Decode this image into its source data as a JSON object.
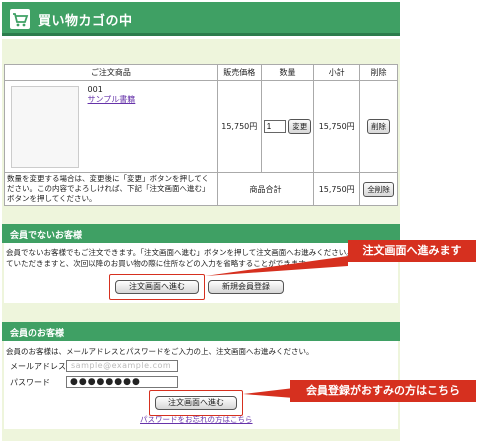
{
  "header": {
    "title": "買い物カゴの中",
    "icon": "cart-icon"
  },
  "cart_table": {
    "columns": [
      "ご注文商品",
      "販売価格",
      "数量",
      "小計",
      "削除"
    ],
    "item": {
      "code": "001",
      "name": "サンプル書籍",
      "price": "15,750円",
      "quantity": "1",
      "change_button": "変更",
      "subtotal": "15,750円",
      "delete_button": "削除"
    },
    "note": "数量を変更する場合は、変更後に「変更」ボタンを押してください。この内容でよろしければ、下記「注文画面へ進む」ボタンを押してください。",
    "total_label": "商品合計",
    "total_value": "15,750円",
    "delete_all_button": "全削除"
  },
  "guest": {
    "title": "会員でないお客様",
    "description": "会員でないお客様でもご注文できます。「注文画面へ進む」ボタンを押して注文画面へお進みください。会員登録していただきますと、次回以降のお買い物の際に住所などの入力を省略することができます。",
    "order_button": "注文画面へ進む",
    "register_button": "新規会員登録"
  },
  "member": {
    "title": "会員のお客様",
    "description": "会員のお客様は、メールアドレスとパスワードをご入力の上、注文画面へお進みください。",
    "email_label": "メールアドレス",
    "email_value": "sample@example.com",
    "password_label": "パスワード",
    "password_value": "●●●●●●●●",
    "order_button": "注文画面へ進む",
    "forgot_link": "パスワードをお忘れの方はこちら"
  },
  "annotations": {
    "callout_1": "注文画面へ進みます",
    "callout_2": "会員登録がおすみの方はこちら"
  },
  "colors": {
    "green": "#3fa064",
    "panel": "#eef5dc",
    "red": "#d6301f",
    "link": "#6633aa"
  }
}
